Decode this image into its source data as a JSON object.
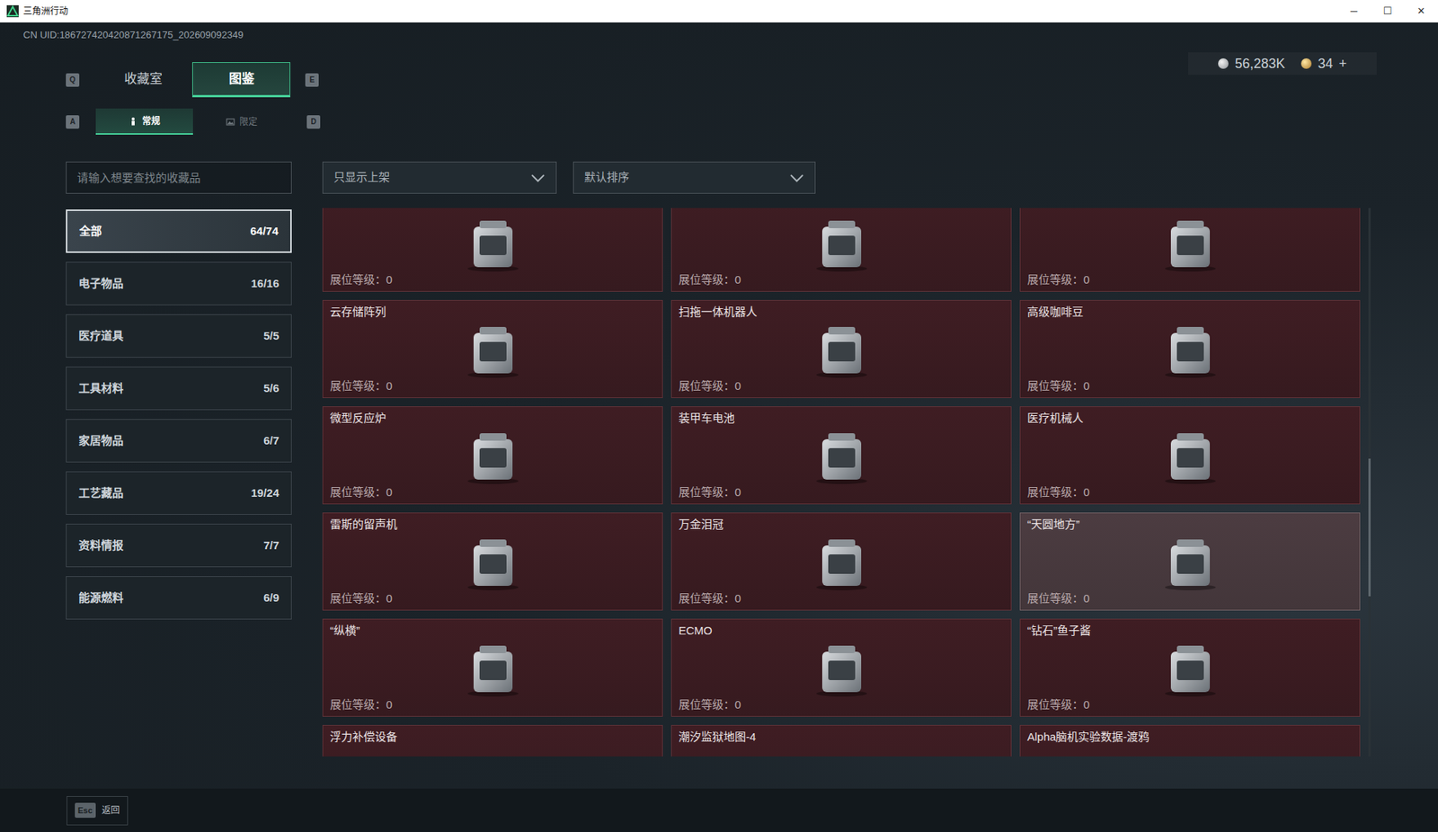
{
  "window": {
    "title": "三角洲行动",
    "controls": [
      "─",
      "☐",
      "✕"
    ]
  },
  "uid": "CN UID:186727420420871267175_202609092349",
  "currency": {
    "coins": "56,283K",
    "tokens": "34",
    "add": "+"
  },
  "tabs": {
    "left_key": "Q",
    "right_key": "E",
    "items": [
      {
        "label": "收藏室",
        "selected": false
      },
      {
        "label": "图鉴",
        "selected": true
      }
    ]
  },
  "subtabs": {
    "left_key": "A",
    "right_key": "D",
    "items": [
      {
        "label": "常规",
        "selected": true
      },
      {
        "label": "限定",
        "selected": false
      }
    ]
  },
  "search": {
    "placeholder": "请输入想要查找的收藏品"
  },
  "filters": [
    {
      "label": "只显示上架"
    },
    {
      "label": "默认排序"
    }
  ],
  "categories": [
    {
      "name": "全部",
      "count": "64/74",
      "selected": true
    },
    {
      "name": "电子物品",
      "count": "16/16",
      "selected": false
    },
    {
      "name": "医疗道具",
      "count": "5/5",
      "selected": false
    },
    {
      "name": "工具材料",
      "count": "5/6",
      "selected": false
    },
    {
      "name": "家居物品",
      "count": "6/7",
      "selected": false
    },
    {
      "name": "工艺藏品",
      "count": "19/24",
      "selected": false
    },
    {
      "name": "资料情报",
      "count": "7/7",
      "selected": false
    },
    {
      "name": "能源燃料",
      "count": "6/9",
      "selected": false
    }
  ],
  "cards": [
    {
      "rank_label": "展位等级：",
      "rank": "0",
      "selected": false
    },
    {
      "rank_label": "展位等级：",
      "rank": "0",
      "selected": false
    },
    {
      "rank_label": "展位等级：",
      "rank": "0",
      "selected": false
    },
    {
      "name": "云存储阵列",
      "rank_label": "展位等级：",
      "rank": "0",
      "selected": false
    },
    {
      "name": "扫拖一体机器人",
      "rank_label": "展位等级：",
      "rank": "0",
      "selected": false
    },
    {
      "name": "高级咖啡豆",
      "rank_label": "展位等级：",
      "rank": "0",
      "selected": false
    },
    {
      "name": "微型反应炉",
      "rank_label": "展位等级：",
      "rank": "0",
      "selected": false
    },
    {
      "name": "装甲车电池",
      "rank_label": "展位等级：",
      "rank": "0",
      "selected": false
    },
    {
      "name": "医疗机械人",
      "rank_label": "展位等级：",
      "rank": "0",
      "selected": false
    },
    {
      "name": "雷斯的留声机",
      "rank_label": "展位等级：",
      "rank": "0",
      "selected": false
    },
    {
      "name": "万金泪冠",
      "rank_label": "展位等级：",
      "rank": "0",
      "selected": false
    },
    {
      "name": "“天圆地方”",
      "rank_label": "展位等级：",
      "rank": "0",
      "selected": true
    },
    {
      "name": "“纵横”",
      "rank_label": "展位等级：",
      "rank": "0",
      "selected": false
    },
    {
      "name": "ECMO",
      "rank_label": "展位等级：",
      "rank": "0",
      "selected": false
    },
    {
      "name": "“钻石”鱼子酱",
      "rank_label": "展位等级：",
      "rank": "0",
      "selected": false
    },
    {
      "name": "浮力补偿设备",
      "selected": false
    },
    {
      "name": "潮汐监狱地图-4",
      "selected": false
    },
    {
      "name": "Alpha脑机实验数据-渡鸦",
      "selected": false
    }
  ],
  "footer": {
    "key": "Esc",
    "label": "返回"
  }
}
